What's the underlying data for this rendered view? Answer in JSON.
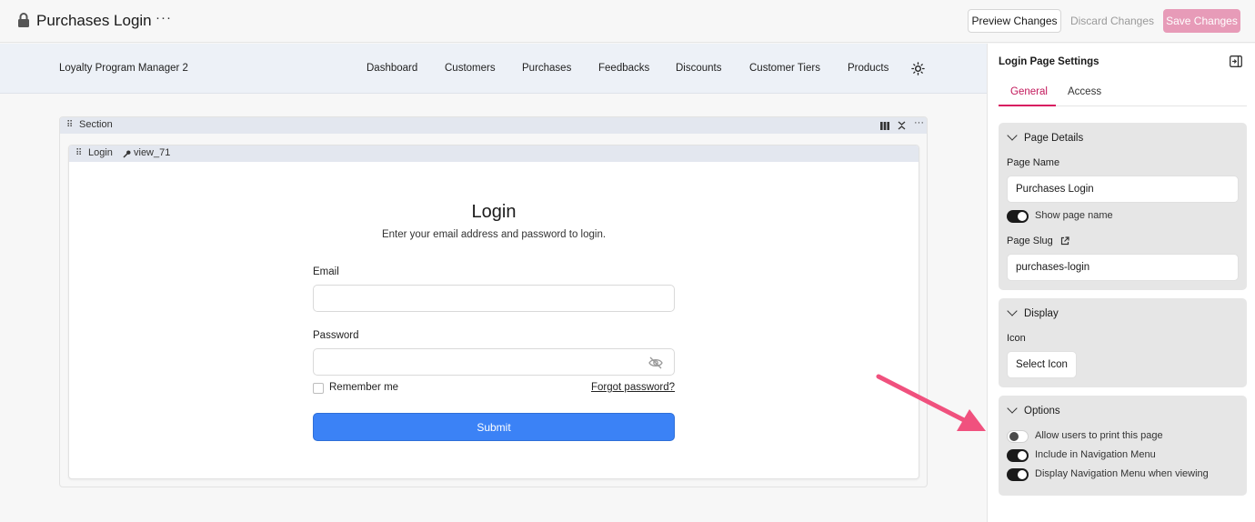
{
  "header": {
    "title": "Purchases Login",
    "more_label": "···",
    "preview_label": "Preview Changes",
    "discard_label": "Discard Changes",
    "save_label": "Save Changes"
  },
  "app_nav": {
    "app_name": "Loyalty Program Manager 2",
    "items": [
      "Dashboard",
      "Customers",
      "Purchases",
      "Feedbacks",
      "Discounts",
      "Customer Tiers",
      "Products"
    ]
  },
  "section": {
    "label": "Section",
    "view": {
      "label": "Login",
      "key": "view_71"
    }
  },
  "login_form": {
    "title": "Login",
    "subtitle": "Enter your email address and password to login.",
    "email_label": "Email",
    "email_value": "",
    "password_label": "Password",
    "password_value": "",
    "remember_label": "Remember me",
    "forgot_label": "Forgot password?",
    "submit_label": "Submit"
  },
  "settings_panel": {
    "title": "Login Page Settings",
    "tabs": [
      "General",
      "Access"
    ],
    "active_tab": "General",
    "page_details": {
      "heading": "Page Details",
      "page_name_label": "Page Name",
      "page_name_value": "Purchases Login",
      "show_page_name_label": "Show page name",
      "show_page_name": true,
      "slug_label": "Page Slug",
      "slug_value": "purchases-login"
    },
    "display": {
      "heading": "Display",
      "icon_label": "Icon",
      "select_icon_label": "Select Icon"
    },
    "options": {
      "heading": "Options",
      "items": [
        {
          "label": "Allow users to print this page",
          "on": false
        },
        {
          "label": "Include in Navigation Menu",
          "on": true
        },
        {
          "label": "Display Navigation Menu when viewing",
          "on": true
        }
      ]
    }
  },
  "colors": {
    "accent": "#d81b60",
    "save_button": "#e79bb8",
    "submit_button": "#3b82f6",
    "arrow": "#f0517e"
  },
  "icons": [
    "lock-icon",
    "sun-icon",
    "grip-icon",
    "columns-icon",
    "collapse-vertical-icon",
    "key-icon",
    "eye-off-icon",
    "external-link-icon",
    "panel-collapse-icon",
    "chevron-down-icon"
  ]
}
